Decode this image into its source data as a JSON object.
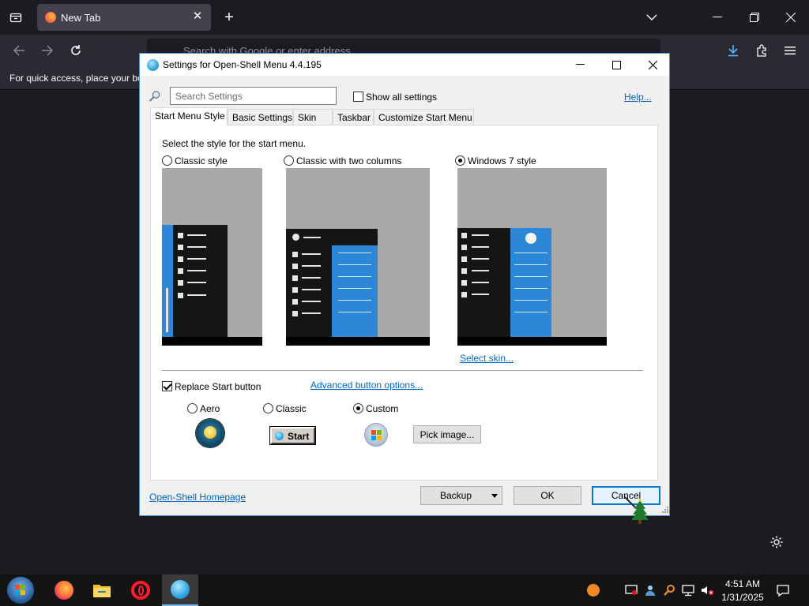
{
  "browser": {
    "tab_title": "New Tab",
    "url_placeholder": "Search with Google or enter address",
    "bookmarks_hint": "For quick access, place your bo"
  },
  "dialog": {
    "title": "Settings for Open-Shell Menu 4.4.195",
    "search_placeholder": "Search Settings",
    "show_all_label": "Show all settings",
    "show_all_checked": false,
    "help_link": "Help...",
    "tabs": [
      {
        "label": "Start Menu Style",
        "active": true
      },
      {
        "label": "Basic Settings",
        "active": false
      },
      {
        "label": "Skin",
        "active": false
      },
      {
        "label": "Taskbar",
        "active": false
      },
      {
        "label": "Customize Start Menu",
        "active": false
      }
    ],
    "style_prompt": "Select the style for the start menu.",
    "styles": [
      {
        "label": "Classic style",
        "selected": false
      },
      {
        "label": "Classic with two columns",
        "selected": false
      },
      {
        "label": "Windows 7 style",
        "selected": true
      }
    ],
    "select_skin_link": "Select skin...",
    "replace_start_label": "Replace Start button",
    "replace_start_checked": true,
    "advanced_link": "Advanced button options...",
    "button_styles": [
      {
        "label": "Aero",
        "selected": false
      },
      {
        "label": "Classic",
        "selected": false
      },
      {
        "label": "Custom",
        "selected": true
      }
    ],
    "classic_start_text": "Start",
    "pick_image_label": "Pick image...",
    "homepage_link": "Open-Shell Homepage",
    "backup_label": "Backup",
    "ok_label": "OK",
    "cancel_label": "Cancel"
  },
  "taskbar": {
    "time": "4:51 AM",
    "date": "1/31/2025"
  },
  "colors": {
    "accent": "#0078d7",
    "preview_blue": "#2c88d6",
    "link": "#0066cc"
  }
}
